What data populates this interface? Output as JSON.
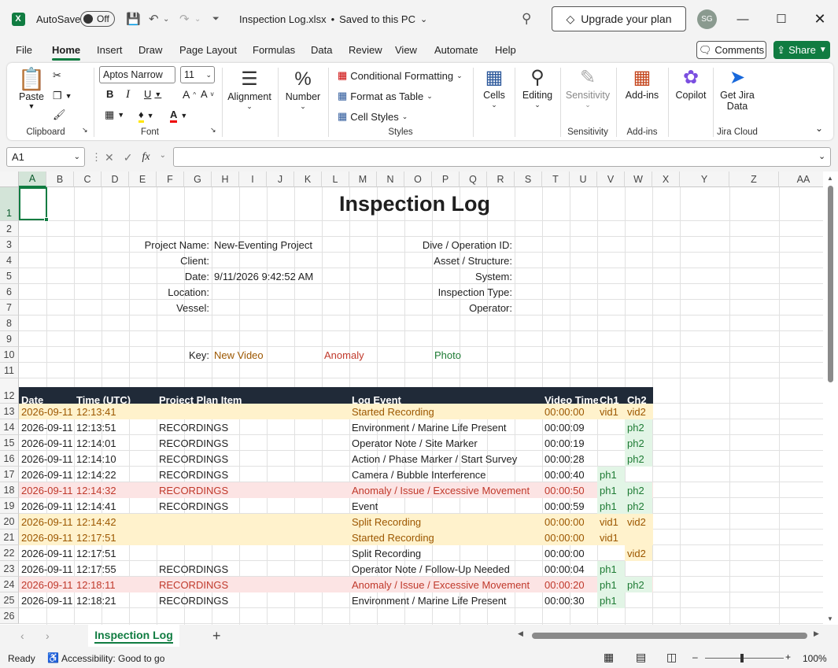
{
  "titlebar": {
    "autosave_label": "AutoSave",
    "toggle_state": "Off",
    "file_title": "Inspection Log.xlsx",
    "saved_status": "Saved to this PC",
    "upgrade_label": "Upgrade your plan",
    "avatar_initials": "SG"
  },
  "menu": {
    "items": [
      "File",
      "Home",
      "Insert",
      "Draw",
      "Page Layout",
      "Formulas",
      "Data",
      "Review",
      "View",
      "Automate",
      "Help"
    ],
    "active": "Home",
    "comments_label": "Comments",
    "share_label": "Share"
  },
  "ribbon": {
    "clipboard": {
      "paste": "Paste",
      "label": "Clipboard"
    },
    "font": {
      "family": "Aptos Narrow",
      "size": "11",
      "label": "Font"
    },
    "alignment": {
      "label": "Alignment"
    },
    "number": {
      "label": "Number"
    },
    "styles": {
      "conditional": "Conditional Formatting",
      "table": "Format as Table",
      "cell": "Cell Styles",
      "label": "Styles"
    },
    "cells": {
      "label": "Cells"
    },
    "editing": {
      "label": "Editing"
    },
    "sensitivity": {
      "btn": "Sensitivity",
      "label": "Sensitivity"
    },
    "addins": {
      "btn": "Add-ins",
      "label": "Add-ins"
    },
    "copilot": {
      "btn": "Copilot"
    },
    "jira": {
      "btn1": "Get Jira",
      "btn2": "Data",
      "label": "Jira Cloud"
    }
  },
  "formula": {
    "namebox": "A1",
    "content": ""
  },
  "columns": [
    "A",
    "B",
    "C",
    "D",
    "E",
    "F",
    "G",
    "H",
    "I",
    "J",
    "K",
    "L",
    "M",
    "N",
    "O",
    "P",
    "Q",
    "R",
    "S",
    "T",
    "U",
    "V",
    "W",
    "X",
    "Y",
    "Z",
    "AA"
  ],
  "rows": [
    "1",
    "2",
    "3",
    "4",
    "5",
    "6",
    "7",
    "8",
    "9",
    "10",
    "11",
    "12",
    "13",
    "14",
    "15",
    "16",
    "17",
    "18",
    "19",
    "20",
    "21",
    "22",
    "23",
    "24",
    "25",
    "26"
  ],
  "sheet": {
    "title": "Inspection Log",
    "info_left": [
      {
        "label": "Project Name:",
        "value": "New-Eventing Project"
      },
      {
        "label": "Client:",
        "value": ""
      },
      {
        "label": "Date:",
        "value": "9/11/2026 9:42:52 AM"
      },
      {
        "label": "Location:",
        "value": ""
      },
      {
        "label": "Vessel:",
        "value": ""
      }
    ],
    "info_right": [
      {
        "label": "Dive / Operation ID:",
        "value": ""
      },
      {
        "label": "Asset / Structure:",
        "value": ""
      },
      {
        "label": "System:",
        "value": ""
      },
      {
        "label": "Inspection Type:",
        "value": ""
      },
      {
        "label": "Operator:",
        "value": ""
      }
    ],
    "key": {
      "label": "Key:",
      "new_video": "New Video",
      "anomaly": "Anomaly",
      "photo": "Photo"
    },
    "headers": {
      "date": "Date",
      "time": "Time (UTC)",
      "plan": "Project Plan Item",
      "event": "Log Event",
      "video": "Video Time",
      "ch1": "Ch1",
      "ch2": "Ch2"
    },
    "log": [
      {
        "date": "2026-09-11",
        "time": "12:13:41",
        "plan": "",
        "event": "Started Recording",
        "video": "00:00:00",
        "ch1": "vid1",
        "ch2": "vid2",
        "kind": "video"
      },
      {
        "date": "2026-09-11",
        "time": "12:13:51",
        "plan": "RECORDINGS",
        "event": "Environment / Marine Life Present",
        "video": "00:00:09",
        "ch1": "",
        "ch2": "ph2",
        "kind": "normal"
      },
      {
        "date": "2026-09-11",
        "time": "12:14:01",
        "plan": "RECORDINGS",
        "event": "Operator Note / Site Marker",
        "video": "00:00:19",
        "ch1": "",
        "ch2": "ph2",
        "kind": "normal"
      },
      {
        "date": "2026-09-11",
        "time": "12:14:10",
        "plan": "RECORDINGS",
        "event": "Action / Phase Marker / Start Survey",
        "video": "00:00:28",
        "ch1": "",
        "ch2": "ph2",
        "kind": "normal"
      },
      {
        "date": "2026-09-11",
        "time": "12:14:22",
        "plan": "RECORDINGS",
        "event": "Camera / Bubble Interference",
        "video": "00:00:40",
        "ch1": "ph1",
        "ch2": "",
        "kind": "normal"
      },
      {
        "date": "2026-09-11",
        "time": "12:14:32",
        "plan": "RECORDINGS",
        "event": "Anomaly / Issue / Excessive Movement",
        "video": "00:00:50",
        "ch1": "ph1",
        "ch2": "ph2",
        "kind": "anomaly"
      },
      {
        "date": "2026-09-11",
        "time": "12:14:41",
        "plan": "RECORDINGS",
        "event": "Event",
        "video": "00:00:59",
        "ch1": "ph1",
        "ch2": "ph2",
        "kind": "normal"
      },
      {
        "date": "2026-09-11",
        "time": "12:14:42",
        "plan": "",
        "event": "Split Recording",
        "video": "00:00:00",
        "ch1": "vid1",
        "ch2": "vid2",
        "kind": "video"
      },
      {
        "date": "2026-09-11",
        "time": "12:17:51",
        "plan": "",
        "event": "Started Recording",
        "video": "00:00:00",
        "ch1": "vid1",
        "ch2": "",
        "kind": "video"
      },
      {
        "date": "2026-09-11",
        "time": "12:17:51",
        "plan": "",
        "event": "Split Recording",
        "video": "00:00:00",
        "ch1": "",
        "ch2": "vid2",
        "kind": "normal"
      },
      {
        "date": "2026-09-11",
        "time": "12:17:55",
        "plan": "RECORDINGS",
        "event": "Operator Note / Follow-Up Needed",
        "video": "00:00:04",
        "ch1": "ph1",
        "ch2": "",
        "kind": "normal"
      },
      {
        "date": "2026-09-11",
        "time": "12:18:11",
        "plan": "RECORDINGS",
        "event": "Anomaly / Issue / Excessive Movement",
        "video": "00:00:20",
        "ch1": "ph1",
        "ch2": "ph2",
        "kind": "anomaly"
      },
      {
        "date": "2026-09-11",
        "time": "12:18:21",
        "plan": "RECORDINGS",
        "event": "Environment / Marine Life Present",
        "video": "00:00:30",
        "ch1": "ph1",
        "ch2": "",
        "kind": "normal"
      }
    ]
  },
  "tabs": {
    "active": "Inspection Log"
  },
  "status": {
    "ready": "Ready",
    "accessibility": "Accessibility: Good to go",
    "zoom": "100%"
  },
  "colors": {
    "excel_green": "#107c41",
    "header_dark": "#202a38",
    "video_fill": "#fff2cc",
    "video_text": "#9c5700",
    "anomaly_fill": "#fce4e4",
    "anomaly_text": "#c0392b",
    "photo_fill": "#e2f5e6",
    "photo_text": "#1e7b34"
  }
}
